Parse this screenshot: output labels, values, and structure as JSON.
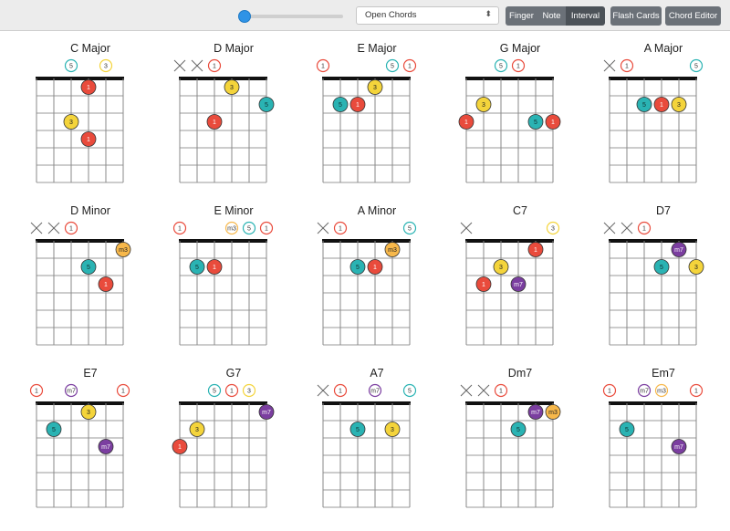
{
  "toolbar": {
    "mode_select": {
      "value": "Open Chords"
    },
    "label_modes": [
      "Finger",
      "Note",
      "Interval"
    ],
    "active_label_mode": "Interval",
    "flash_cards_label": "Flash Cards",
    "chord_editor_label": "Chord Editor"
  },
  "colors": {
    "1": "#e94b3c",
    "3": "#f4d43b",
    "m3": "#f7b84b",
    "5": "#2ab3b3",
    "m7": "#7b3ea0"
  },
  "chords": [
    {
      "name": "C Major",
      "open": [
        [
          2,
          "5"
        ],
        [
          4,
          "3"
        ]
      ],
      "mute": [],
      "dots": [
        [
          1,
          3,
          "1"
        ],
        [
          3,
          2,
          "3"
        ],
        [
          4,
          3,
          "1"
        ]
      ]
    },
    {
      "name": "D Major",
      "open": [
        [
          2,
          "1"
        ]
      ],
      "mute": [
        0,
        1
      ],
      "dots": [
        [
          1,
          3,
          "3"
        ],
        [
          2,
          5,
          "5"
        ],
        [
          3,
          2,
          "1"
        ]
      ]
    },
    {
      "name": "E Major",
      "open": [
        [
          0,
          "1"
        ],
        [
          4,
          "5"
        ],
        [
          5,
          "1"
        ]
      ],
      "mute": [],
      "dots": [
        [
          1,
          3,
          "3"
        ],
        [
          2,
          1,
          "5"
        ],
        [
          2,
          2,
          "1"
        ]
      ]
    },
    {
      "name": "G Major",
      "open": [
        [
          2,
          "5"
        ],
        [
          3,
          "1"
        ]
      ],
      "mute": [],
      "dots": [
        [
          2,
          1,
          "3"
        ],
        [
          3,
          0,
          "1"
        ],
        [
          3,
          4,
          "5"
        ],
        [
          3,
          5,
          "1"
        ]
      ]
    },
    {
      "name": "A Major",
      "open": [
        [
          1,
          "1"
        ],
        [
          5,
          "5"
        ]
      ],
      "mute": [
        0
      ],
      "dots": [
        [
          2,
          2,
          "5"
        ],
        [
          2,
          3,
          "1"
        ],
        [
          2,
          4,
          "3"
        ]
      ]
    },
    {
      "name": "D Minor",
      "open": [
        [
          2,
          "1"
        ]
      ],
      "mute": [
        0,
        1
      ],
      "dots": [
        [
          1,
          5,
          "m3"
        ],
        [
          2,
          3,
          "5"
        ],
        [
          3,
          4,
          "1"
        ]
      ]
    },
    {
      "name": "E Minor",
      "open": [
        [
          0,
          "1"
        ],
        [
          3,
          "m3"
        ],
        [
          4,
          "5"
        ],
        [
          5,
          "1"
        ]
      ],
      "mute": [],
      "dots": [
        [
          2,
          1,
          "5"
        ],
        [
          2,
          2,
          "1"
        ]
      ]
    },
    {
      "name": "A Minor",
      "open": [
        [
          1,
          "1"
        ],
        [
          5,
          "5"
        ]
      ],
      "mute": [
        0
      ],
      "dots": [
        [
          1,
          4,
          "m3"
        ],
        [
          2,
          2,
          "5"
        ],
        [
          2,
          3,
          "1"
        ]
      ]
    },
    {
      "name": "C7",
      "open": [
        [
          5,
          "3"
        ]
      ],
      "mute": [
        0
      ],
      "dots": [
        [
          1,
          4,
          "1"
        ],
        [
          2,
          2,
          "3"
        ],
        [
          3,
          1,
          "1"
        ],
        [
          3,
          3,
          "m7"
        ]
      ]
    },
    {
      "name": "D7",
      "open": [
        [
          2,
          "1"
        ]
      ],
      "mute": [
        0,
        1
      ],
      "dots": [
        [
          1,
          4,
          "m7"
        ],
        [
          2,
          3,
          "5"
        ],
        [
          2,
          5,
          "3"
        ]
      ]
    },
    {
      "name": "E7",
      "open": [
        [
          0,
          "1"
        ],
        [
          2,
          "m7"
        ],
        [
          5,
          "1"
        ]
      ],
      "mute": [],
      "dots": [
        [
          1,
          3,
          "3"
        ],
        [
          2,
          1,
          "5"
        ],
        [
          3,
          4,
          "m7"
        ]
      ]
    },
    {
      "name": "G7",
      "open": [
        [
          2,
          "5"
        ],
        [
          3,
          "1"
        ],
        [
          4,
          "3"
        ]
      ],
      "mute": [],
      "dots": [
        [
          1,
          5,
          "m7"
        ],
        [
          2,
          1,
          "3"
        ],
        [
          3,
          0,
          "1"
        ]
      ]
    },
    {
      "name": "A7",
      "open": [
        [
          1,
          "1"
        ],
        [
          3,
          "m7"
        ],
        [
          5,
          "5"
        ]
      ],
      "mute": [
        0
      ],
      "dots": [
        [
          2,
          2,
          "5"
        ],
        [
          2,
          4,
          "3"
        ]
      ]
    },
    {
      "name": "Dm7",
      "open": [
        [
          2,
          "1"
        ]
      ],
      "mute": [
        0,
        1
      ],
      "dots": [
        [
          1,
          4,
          "m7"
        ],
        [
          1,
          5,
          "m3"
        ],
        [
          2,
          3,
          "5"
        ]
      ]
    },
    {
      "name": "Em7",
      "open": [
        [
          0,
          "1"
        ],
        [
          2,
          "m7"
        ],
        [
          3,
          "m3"
        ],
        [
          5,
          "1"
        ]
      ],
      "mute": [],
      "dots": [
        [
          2,
          1,
          "5"
        ],
        [
          3,
          4,
          "m7"
        ]
      ]
    }
  ]
}
